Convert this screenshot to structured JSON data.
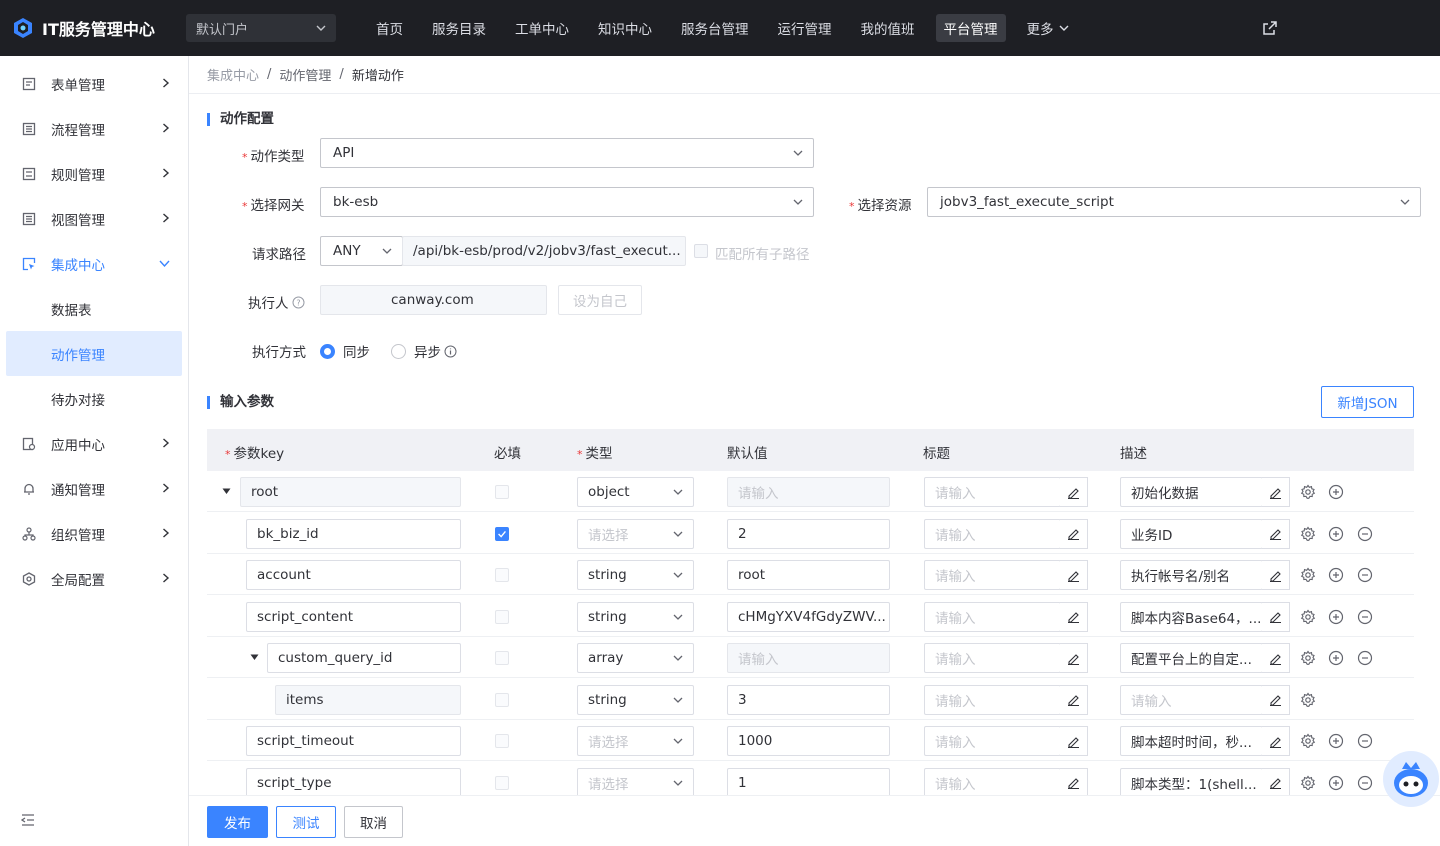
{
  "app": {
    "title": "IT服务管理中心",
    "portal": "默认门户"
  },
  "topnav": [
    {
      "label": "首页",
      "active": false
    },
    {
      "label": "服务目录",
      "active": false
    },
    {
      "label": "工单中心",
      "active": false
    },
    {
      "label": "知识中心",
      "active": false
    },
    {
      "label": "服务台管理",
      "active": false
    },
    {
      "label": "运行管理",
      "active": false
    },
    {
      "label": "我的值班",
      "active": false
    },
    {
      "label": "平台管理",
      "active": true
    },
    {
      "label": "更多",
      "active": false
    }
  ],
  "sidebar": {
    "items": [
      {
        "label": "表单管理",
        "icon": "form-icon"
      },
      {
        "label": "流程管理",
        "icon": "flow-icon"
      },
      {
        "label": "规则管理",
        "icon": "rule-icon"
      },
      {
        "label": "视图管理",
        "icon": "view-icon"
      },
      {
        "label": "集成中心",
        "icon": "integration-icon",
        "open": true
      },
      {
        "label": "应用中心",
        "icon": "app-icon"
      },
      {
        "label": "通知管理",
        "icon": "bell-icon"
      },
      {
        "label": "组织管理",
        "icon": "org-icon"
      },
      {
        "label": "全局配置",
        "icon": "settings-icon"
      }
    ],
    "sub": [
      {
        "label": "数据表",
        "active": false
      },
      {
        "label": "动作管理",
        "active": true
      },
      {
        "label": "待办对接",
        "active": false
      }
    ]
  },
  "breadcrumb": {
    "root": "集成中心",
    "mid": "动作管理",
    "current": "新增动作",
    "sep": "/"
  },
  "config": {
    "section_title": "动作配置",
    "action_type": {
      "label": "动作类型",
      "value": "API"
    },
    "gateway": {
      "label": "选择网关",
      "value": "bk-esb"
    },
    "resource": {
      "label": "选择资源",
      "value": "jobv3_fast_execute_script"
    },
    "path": {
      "label": "请求路径",
      "method": "ANY",
      "value": "/api/bk-esb/prod/v2/jobv3/fast_execut...",
      "match_all": "匹配所有子路径"
    },
    "executor": {
      "label": "执行人",
      "value": "canway.com",
      "self_btn": "设为自己"
    },
    "mode": {
      "label": "执行方式",
      "sync": "同步",
      "async": "异步",
      "selected": "sync"
    }
  },
  "params": {
    "section_title": "输入参数",
    "add_json": "新增JSON",
    "headers": {
      "key": "参数key",
      "required": "必填",
      "type": "类型",
      "default": "默认值",
      "title": "标题",
      "desc": "描述"
    },
    "rows": [
      {
        "key": "root",
        "required": false,
        "type": "object",
        "type_ph": false,
        "default": "请输入",
        "default_ph": true,
        "title": "请输入",
        "desc": "初始化数据",
        "desc_ph": false,
        "level": 0,
        "expanded": true,
        "minus": false
      },
      {
        "key": "bk_biz_id",
        "required": true,
        "type": "请选择",
        "type_ph": true,
        "default": "2",
        "default_ph": false,
        "title": "请输入",
        "desc": "业务ID",
        "desc_ph": false,
        "level": 1,
        "minus": true
      },
      {
        "key": "account",
        "required": false,
        "type": "string",
        "type_ph": false,
        "default": "root",
        "default_ph": false,
        "title": "请输入",
        "desc": "执行帐号名/别名",
        "desc_ph": false,
        "level": 1,
        "minus": true
      },
      {
        "key": "script_content",
        "required": false,
        "type": "string",
        "type_ph": false,
        "default": "cHMgYXV4fGdyZWV...",
        "default_ph": false,
        "title": "请输入",
        "desc": "脚本内容Base64，...",
        "desc_ph": false,
        "level": 1,
        "minus": true
      },
      {
        "key": "custom_query_id",
        "required": false,
        "type": "array",
        "type_ph": false,
        "default": "请输入",
        "default_ph": true,
        "title": "请输入",
        "desc": "配置平台上的自定...",
        "desc_ph": false,
        "level": 1,
        "expanded": true,
        "minus": true
      },
      {
        "key": "items",
        "required": false,
        "type": "string",
        "type_ph": false,
        "default": "3",
        "default_ph": false,
        "title": "请输入",
        "desc": "请输入",
        "desc_ph": true,
        "level": 2,
        "minus": false,
        "no_add": true
      },
      {
        "key": "script_timeout",
        "required": false,
        "type": "请选择",
        "type_ph": true,
        "default": "1000",
        "default_ph": false,
        "title": "请输入",
        "desc": "脚本超时时间，秒...",
        "desc_ph": false,
        "level": 1,
        "minus": true
      },
      {
        "key": "script_type",
        "required": false,
        "type": "请选择",
        "type_ph": true,
        "default": "1",
        "default_ph": false,
        "title": "请输入",
        "desc": "脚本类型：1(shell...",
        "desc_ph": false,
        "level": 1,
        "minus": true
      }
    ]
  },
  "footer": {
    "publish": "发布",
    "test": "测试",
    "cancel": "取消"
  },
  "colors": {
    "primary": "#3a84ff",
    "topbar": "#1e1f24",
    "danger": "#ea3636"
  }
}
